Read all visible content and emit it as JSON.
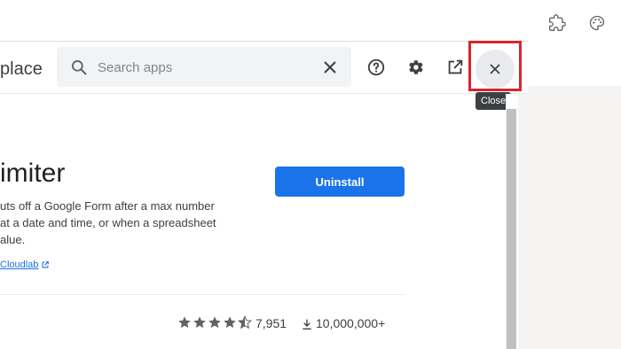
{
  "header": {
    "title_partial": "place",
    "search": {
      "placeholder": "Search apps",
      "value": ""
    },
    "close_tooltip": "Close"
  },
  "app": {
    "title_partial": "imiter",
    "description_lines": [
      "uts off a Google Form after a max number",
      "at a date and time, or when a spreadsheet",
      "alue."
    ],
    "developer_link": "Cloudlab",
    "action_label": "Uninstall",
    "rating": 4.5,
    "rating_count": "7,951",
    "downloads": "10,000,000+"
  },
  "colors": {
    "accent": "#1a73e8",
    "highlight_box": "#d9252d",
    "icon": "#5f6368"
  }
}
